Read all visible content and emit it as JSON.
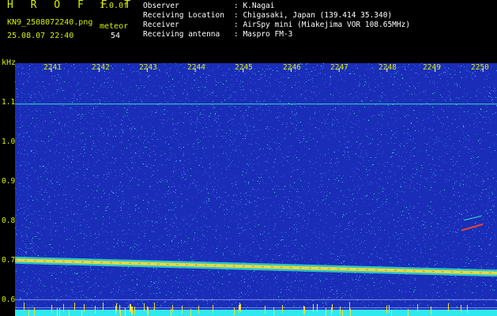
{
  "header": {
    "brand": "H R O F F T",
    "version": "1.0.0f",
    "filename": "KN9_2508072240.png",
    "meteor_label": "meteor",
    "datetime": "25.08.07 22:40",
    "meteor_count": "54"
  },
  "info": [
    {
      "key": "Observer",
      "value": ": K.Nagai"
    },
    {
      "key": "Receiving Location",
      "value": ": Chigasaki, Japan (139.414 35.340)"
    },
    {
      "key": "Receiver",
      "value": ": AirSpy mini (Miakejima VOR 108.65MHz)"
    },
    {
      "key": "Receiving antenna",
      "value": ": Maspro FM-3"
    }
  ],
  "chart_data": {
    "type": "heatmap",
    "ylabel": "kHz",
    "y_ticks": [
      "1.1",
      "1.0",
      "0.9",
      "0.8",
      "0.7",
      "0.6"
    ],
    "x_ticks": [
      "2241",
      "2242",
      "2243",
      "2244",
      "2245",
      "2246",
      "2247",
      "2248",
      "2249",
      "2250"
    ],
    "ylim": [
      0.58,
      1.2
    ],
    "carrier_line": {
      "start_khz": 0.717,
      "end_khz": 0.685
    },
    "interference_line_khz": 1.1,
    "colors": {
      "background": "#1a2db8",
      "noise": "#2f5fe0",
      "signal": "#35e6c8",
      "strong": "#f2e23a",
      "peak": "#e2463a"
    }
  }
}
